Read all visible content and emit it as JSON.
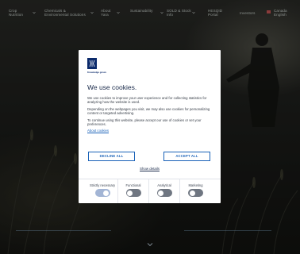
{
  "nav": {
    "items": [
      {
        "label": "Crop Nutrition",
        "has_dropdown": true
      },
      {
        "label": "Chemicals & Environmental Solutions",
        "has_dropdown": true
      },
      {
        "label": "About Yara",
        "has_dropdown": true
      },
      {
        "label": "Sustainability",
        "has_dropdown": true
      },
      {
        "label": "SOLD & Stock Info",
        "has_dropdown": true
      },
      {
        "label": "HESQID Portal",
        "has_dropdown": false
      },
      {
        "label": "Investors",
        "has_dropdown": false
      },
      {
        "label": "Canada English",
        "has_dropdown": false
      }
    ]
  },
  "cookie_dialog": {
    "logo_tagline": "Knowledge grows",
    "title": "We use cookies.",
    "paragraphs": [
      "We use cookies to improve your user experience and for collecting statistics for analyzing how the website is used.",
      "Depending on the webpages you visit, we may also use cookies for personalizing content or targeted advertising.",
      "To continue using this website, please accept our use of cookies or set your preferences."
    ],
    "about_link": "About cookies",
    "decline_label": "DECLINE ALL",
    "accept_label": "ACCEPT ALL",
    "show_details_label": "Show details",
    "preferences": [
      {
        "label": "Strictly necessary",
        "enabled": true
      },
      {
        "label": "Functional",
        "enabled": false
      },
      {
        "label": "Analytical",
        "enabled": false
      },
      {
        "label": "Marketing",
        "enabled": false
      }
    ]
  },
  "colors": {
    "brand_blue": "#0b2a6b",
    "link_blue": "#1a62b8",
    "toggle_off": "#6f7681",
    "toggle_on": "#a3b5d5"
  }
}
